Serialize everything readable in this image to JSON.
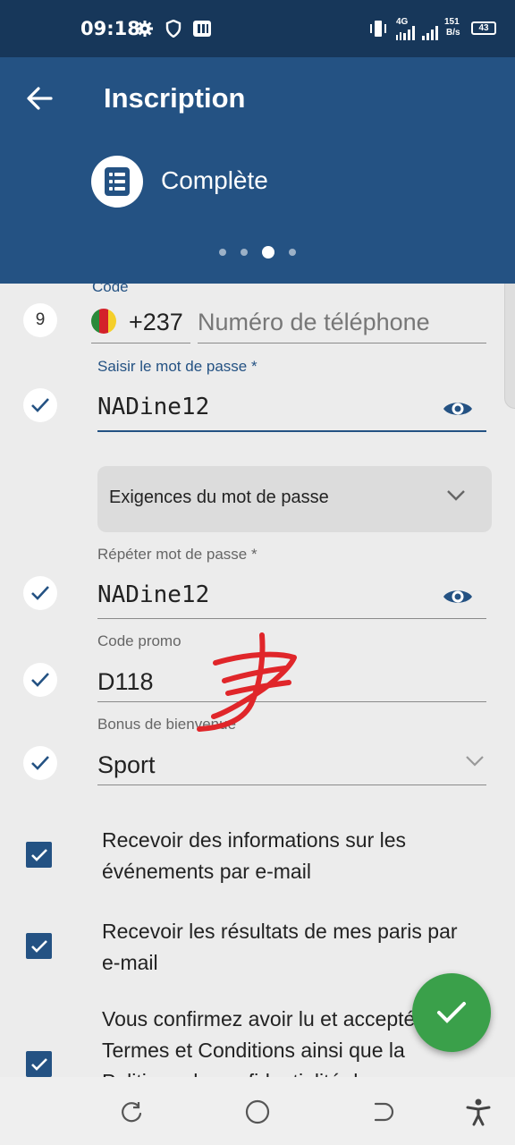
{
  "status_bar": {
    "time": "09:18",
    "network": "4G",
    "speed_value": "151",
    "speed_unit": "B/s",
    "battery": "43",
    "icons": [
      "gear-icon",
      "shield-icon",
      "parking-icon",
      "vibrate-icon",
      "signal-icon",
      "signal-icon"
    ]
  },
  "header": {
    "title": "Inscription",
    "step_label": "Complète",
    "step_icon": "list-icon",
    "pager_total": 4,
    "pager_active": 3
  },
  "form": {
    "phone": {
      "code_label": "Code",
      "step_number": "9",
      "country_code": "+237",
      "phone_placeholder": "Numéro de téléphone"
    },
    "password": {
      "label": "Saisir le mot de passe *",
      "value": "NADine12"
    },
    "requirements": {
      "label": "Exigences du mot de passe"
    },
    "repeat_password": {
      "label": "Répéter mot de passe *",
      "value": "NADine12"
    },
    "promo": {
      "label": "Code promo",
      "value": "D118"
    },
    "bonus": {
      "label": "Bonus de bienvenue",
      "value": "Sport"
    },
    "checkboxes": [
      {
        "text": "Recevoir des informations sur les événements par e-mail",
        "checked": true
      },
      {
        "text": "Recevoir les résultats de mes paris par e-mail",
        "checked": true
      },
      {
        "text": "Vous confirmez avoir lu et accepté les Termes et Conditions ainsi que la Politique de confidentialité de",
        "checked": true
      }
    ]
  },
  "colors": {
    "header_blue": "#245283",
    "status_bar": "#17375a",
    "fab_green": "#3aa04a",
    "scribble_red": "#e0262a"
  }
}
